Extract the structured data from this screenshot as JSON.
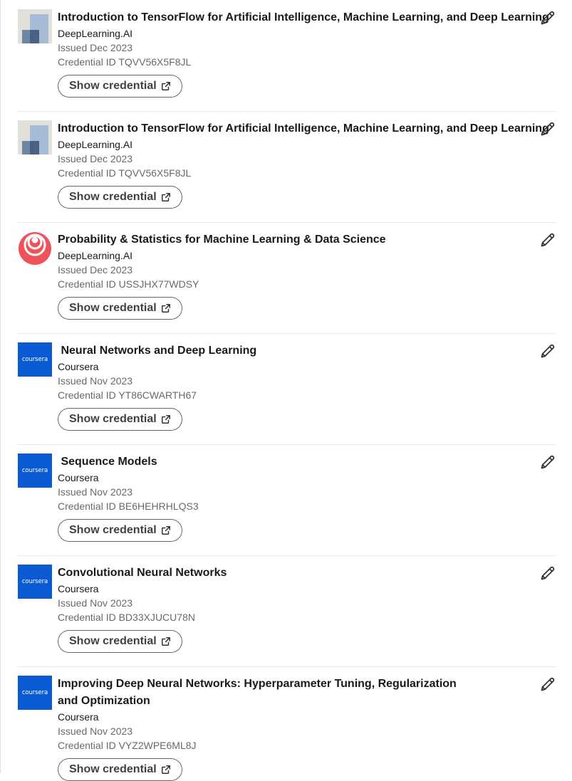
{
  "licenses": [
    {
      "logo": "tensorflow-logo",
      "title": "Introduction to TensorFlow for Artificial Intelligence, Machine Learning, and Deep Learning",
      "issuer": "DeepLearning.AI",
      "issued": "Issued Dec 2023",
      "credential_id": "Credential ID TQVV56X5F8JL",
      "button_label": "Show credential"
    },
    {
      "logo": "tensorflow-logo",
      "title": "Introduction to TensorFlow for Artificial Intelligence, Machine Learning, and Deep Learning",
      "issuer": "DeepLearning.AI",
      "issued": "Issued Dec 2023",
      "credential_id": "Credential ID TQVV56X5F8JL",
      "button_label": "Show credential"
    },
    {
      "logo": "deeplearning-ai-logo",
      "title": "Probability & Statistics for Machine Learning & Data Science",
      "issuer": "DeepLearning.AI",
      "issued": "Issued Dec 2023",
      "credential_id": "Credential ID USSJHX77WDSY",
      "button_label": "Show credential"
    },
    {
      "logo": "coursera-logo",
      "title": " Neural Networks and Deep Learning",
      "issuer": "Coursera",
      "issued": "Issued Nov 2023",
      "credential_id": "Credential ID YT86CWARTH67",
      "button_label": "Show credential"
    },
    {
      "logo": "coursera-logo",
      "title": " Sequence Models",
      "issuer": "Coursera",
      "issued": "Issued Nov 2023",
      "credential_id": "Credential ID BE6HEHRHLQS3",
      "button_label": "Show credential"
    },
    {
      "logo": "coursera-logo",
      "title": "Convolutional Neural Networks",
      "issuer": "Coursera",
      "issued": "Issued Nov 2023",
      "credential_id": "Credential ID BD33XJUCU78N",
      "button_label": "Show credential"
    },
    {
      "logo": "coursera-logo",
      "title": "Improving Deep Neural Networks: Hyperparameter Tuning, Regularization and Optimization",
      "issuer": "Coursera",
      "issued": "Issued Nov 2023",
      "credential_id": "Credential ID VYZ2WPE6ML8J",
      "button_label": "Show credential"
    }
  ],
  "coursera_logo_text": "coursera",
  "colors": {
    "coursera_blue": "#0a5bd3",
    "deeplearning_red": "#f0525c",
    "text_primary": "rgba(0,0,0,0.9)",
    "text_secondary": "rgba(0,0,0,0.6)"
  }
}
